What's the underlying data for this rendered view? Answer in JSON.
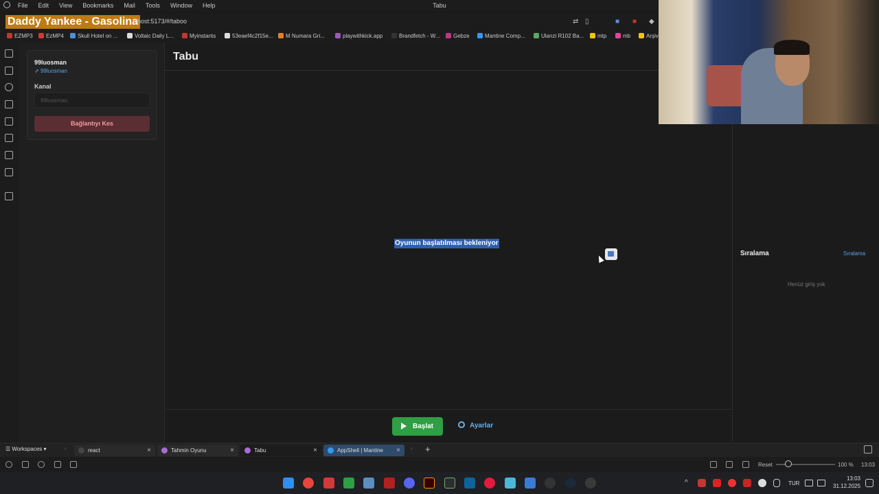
{
  "window": {
    "title": "Tabu"
  },
  "menu": [
    "File",
    "Edit",
    "View",
    "Bookmarks",
    "Mail",
    "Tools",
    "Window",
    "Help"
  ],
  "overlay": {
    "now_playing": "Daddy Yankee - Gasolina"
  },
  "address": {
    "url": "lhost:5173/#/taboo"
  },
  "bookmarks": [
    {
      "label": "EZMP3",
      "color": "#c0392b"
    },
    {
      "label": "EzMP4",
      "color": "#d33"
    },
    {
      "label": "Skull Hotel on ...",
      "color": "#4a90d9"
    },
    {
      "label": "Voltaic Daily L...",
      "color": "#ddd"
    },
    {
      "label": "Myinstants",
      "color": "#c0392b"
    },
    {
      "label": "53eaef4c2f15e...",
      "color": "#ddd"
    },
    {
      "label": "M Numara Gri...",
      "color": "#e67e22"
    },
    {
      "label": "playwithkick.app",
      "color": "#9b59b6"
    },
    {
      "label": "Brandfetch - W...",
      "color": "#333"
    },
    {
      "label": "Gebze",
      "color": "#c13584"
    },
    {
      "label": "Mantine Comp...",
      "color": "#339af0"
    },
    {
      "label": "Ulanzi R102 Ba...",
      "color": "#5a6"
    },
    {
      "label": "mtp",
      "color": "#f1c40f"
    },
    {
      "label": "mb",
      "color": "#e84393"
    },
    {
      "label": "Arşiv",
      "color": "#f1c40f"
    }
  ],
  "sidebar": {
    "username": "99luosman",
    "user_link": "99luosman",
    "channel_label": "Kanal",
    "channel_placeholder": "99luosman",
    "disconnect_label": "Bağlantıyı Kes"
  },
  "main": {
    "title": "Tabu",
    "status": "Oyunun başlatılması bekleniyor",
    "start_label": "Başlat",
    "settings_label": "Ayarlar"
  },
  "ranking": {
    "title": "Sıralama",
    "link": "Sıralama",
    "empty": "Henüz giriş yok"
  },
  "tabs": {
    "workspaces": "Workspaces",
    "items": [
      {
        "label": "react",
        "active": false
      },
      {
        "label": "Tahmin Oyunu",
        "active": false
      },
      {
        "label": "Tabu",
        "active": true
      },
      {
        "label": "AppShell | Mantine",
        "active": false
      }
    ]
  },
  "status": {
    "reset_label": "Reset",
    "zoom": "100 %",
    "time": "13:03"
  },
  "taskbar": {
    "lang": "TUR",
    "clock_time": "13:03",
    "clock_date": "31.12.2025"
  }
}
